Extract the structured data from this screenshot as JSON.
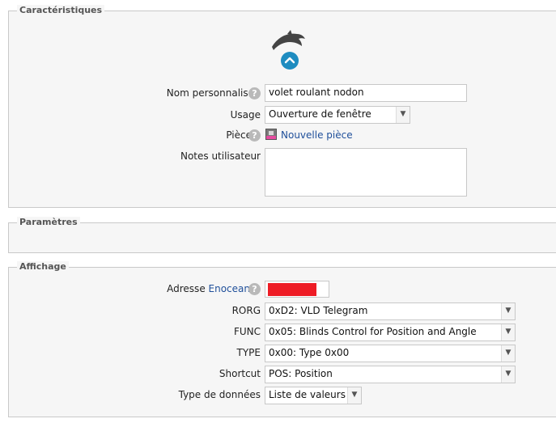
{
  "sections": {
    "caracteristiques": "Caractéristiques",
    "parametres": "Paramètres",
    "affichage": "Affichage"
  },
  "icons": {
    "device": "dolphin-icon",
    "expand": "chevron-up-icon"
  },
  "fields": {
    "nom": {
      "label": "Nom personnalisé",
      "value": "volet roulant nodon"
    },
    "usage": {
      "label": "Usage",
      "value": "Ouverture de fenêtre"
    },
    "piece": {
      "label": "Pièce",
      "value": "Nouvelle pièce"
    },
    "notes": {
      "label": "Notes utilisateur",
      "value": ""
    },
    "adresse": {
      "label_prefix": "Adresse",
      "label_link": "Enocean",
      "value": ""
    },
    "rorg": {
      "label": "RORG",
      "value": "0xD2: VLD Telegram"
    },
    "func": {
      "label": "FUNC",
      "value": "0x05: Blinds Control for Position and Angle"
    },
    "type": {
      "label": "TYPE",
      "value": "0x00: Type 0x00"
    },
    "shortcut": {
      "label": "Shortcut",
      "value": "POS: Position"
    },
    "type_donnees": {
      "label": "Type de données",
      "value": "Liste de valeurs"
    }
  },
  "colors": {
    "accent": "#1e8cc0",
    "redacted": "#ee1c25",
    "link": "#1f4f9a"
  }
}
